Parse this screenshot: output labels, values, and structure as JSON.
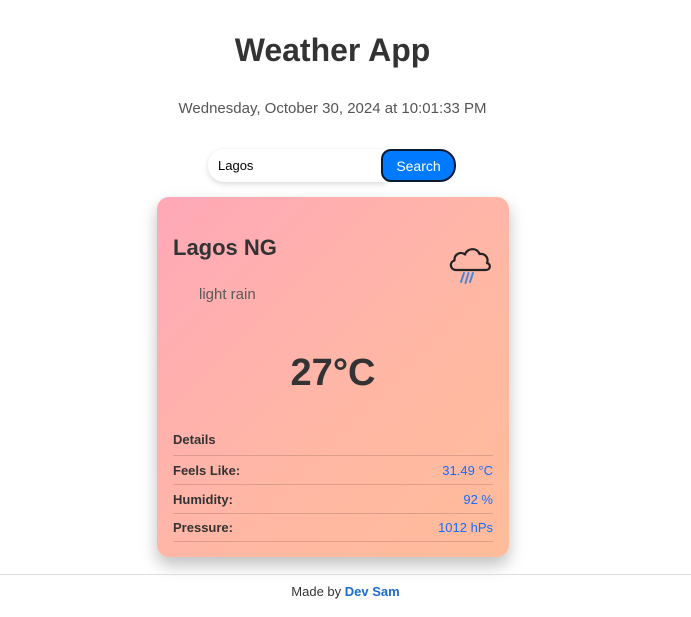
{
  "app": {
    "title": "Weather App",
    "datetime": "Wednesday, October 30, 2024 at 10:01:33 PM"
  },
  "search": {
    "value": "Lagos",
    "button_label": "Search"
  },
  "weather": {
    "location": "Lagos NG",
    "condition": "light rain",
    "icon": "rain-cloud-icon",
    "temperature": "27°C",
    "details_heading": "Details",
    "details": [
      {
        "label": "Feels Like:",
        "value": "31.49 °C"
      },
      {
        "label": "Humidity:",
        "value": "92 %"
      },
      {
        "label": "Pressure:",
        "value": "1012 hPs"
      }
    ]
  },
  "footer": {
    "prefix": "Made by",
    "author": "Dev Sam"
  },
  "colors": {
    "accent": "#007bff",
    "value_text": "#1a6bff",
    "card_gradient_start": "#ffa8b8",
    "card_gradient_end": "#ffbc9a"
  }
}
